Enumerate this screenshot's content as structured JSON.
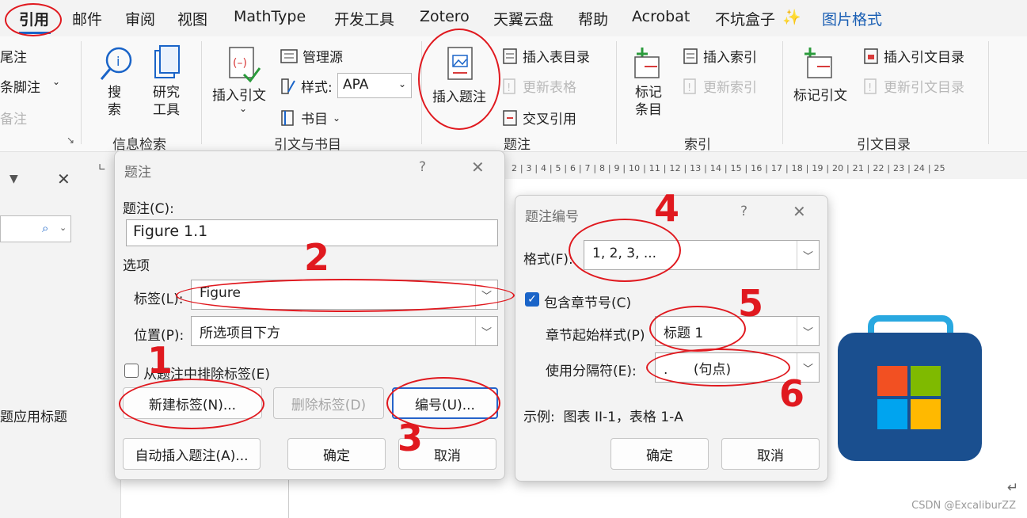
{
  "menu": {
    "tabs": [
      {
        "label": "引用"
      },
      {
        "label": "邮件"
      },
      {
        "label": "审阅"
      },
      {
        "label": "视图"
      },
      {
        "label": "MathType"
      },
      {
        "label": "开发工具"
      },
      {
        "label": "Zotero"
      },
      {
        "label": "天翼云盘"
      },
      {
        "label": "帮助"
      },
      {
        "label": "Acrobat"
      },
      {
        "label": "不坑盒子"
      },
      {
        "label": "图片格式"
      }
    ],
    "sparkle": "✨"
  },
  "ribbon": {
    "footnotes": {
      "endnote": "尾注",
      "next_footnote": "条脚注",
      "show_notes": "备注"
    },
    "research": {
      "search": "搜\n索",
      "researcher": "研究\n工具",
      "group": "信息检索"
    },
    "citations": {
      "insert_citation": "插入引文",
      "manage_sources": "管理源",
      "style_label": "样式:",
      "style_value": "APA",
      "bibliography": "书目",
      "group": "引文与书目"
    },
    "captions": {
      "insert_caption": "插入题注",
      "insert_tof": "插入表目录",
      "update_table": "更新表格",
      "cross_ref": "交叉引用",
      "group": "题注"
    },
    "index": {
      "mark_entry": "标记\n条目",
      "insert_index": "插入索引",
      "update_index": "更新索引",
      "group": "索引"
    },
    "toa": {
      "mark_citation": "标记引文",
      "insert_toa": "插入引文目录",
      "update_toa": "更新引文目录",
      "group": "引文目录"
    }
  },
  "leftpane": {
    "heading_text": "题应用标题"
  },
  "ruler": {
    "ticks": "2 | 3 | 4 | 5 | 6 | 7 | 8 | 9 | 10 | 11 | 12 | 13 | 14 | 15 | 16 | 17 | 18 | 19 | 20 | 21 | 22 | 23 | 24 | 25"
  },
  "caption_dialog": {
    "title": "题注",
    "help": "?",
    "close": "✕",
    "caption_label": "题注(C):",
    "caption_value": "Figure 1.1",
    "options_label": "选项",
    "label_label": "标签(L):",
    "label_value": "Figure",
    "position_label": "位置(P):",
    "position_value": "所选项目下方",
    "exclude_label": "从题注中排除标签(E)",
    "new_label_btn": "新建标签(N)...",
    "delete_label_btn": "删除标签(D)",
    "numbering_btn": "编号(U)...",
    "autocaption_btn": "自动插入题注(A)...",
    "ok_btn": "确定",
    "cancel_btn": "取消"
  },
  "numbering_dialog": {
    "title": "题注编号",
    "help": "?",
    "close": "✕",
    "format_label": "格式(F):",
    "format_value": "1, 2, 3, ...",
    "include_chapter_label": "包含章节号(C)",
    "chapter_style_label": "章节起始样式(P)",
    "chapter_style_value": "标题 1",
    "separator_label": "使用分隔符(E):",
    "separator_value": ".      (句点)",
    "example_text": "示例:  图表 II-1，表格 1-A",
    "ok_btn": "确定",
    "cancel_btn": "取消"
  },
  "annotations": {
    "n1": "1",
    "n2": "2",
    "n3": "3",
    "n4": "4",
    "n5": "5",
    "n6": "6"
  },
  "watermark": "CSDN @ExcaliburZZ",
  "colors": {
    "annotation_red": "#e0191f",
    "accent_blue": "#1a64c8",
    "ms_red": "#f25022",
    "ms_green": "#7fba00",
    "ms_blue": "#00a4ef",
    "ms_yellow": "#ffb900"
  }
}
